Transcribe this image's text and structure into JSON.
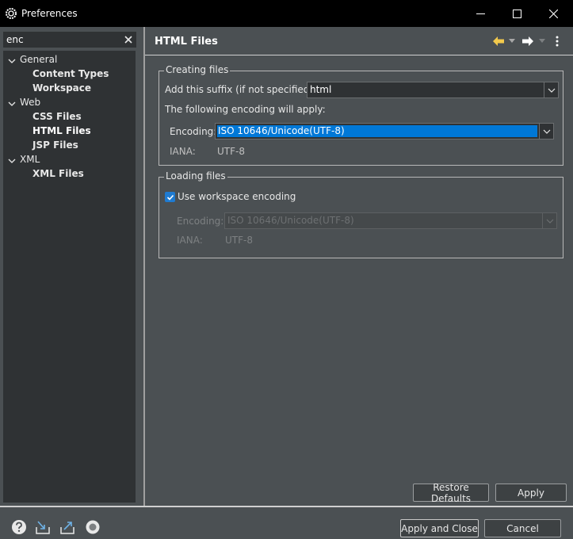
{
  "window": {
    "title": "Preferences",
    "icon": "eclipse-gear-icon"
  },
  "filter": {
    "value": "enc"
  },
  "tree": [
    {
      "label": "General",
      "level": 0,
      "expanded": true
    },
    {
      "label": "Content Types",
      "level": 1
    },
    {
      "label": "Workspace",
      "level": 1
    },
    {
      "label": "Web",
      "level": 0,
      "expanded": true
    },
    {
      "label": "CSS Files",
      "level": 1
    },
    {
      "label": "HTML Files",
      "level": 1,
      "selected": true
    },
    {
      "label": "JSP Files",
      "level": 1
    },
    {
      "label": "XML",
      "level": 0,
      "expanded": true
    },
    {
      "label": "XML Files",
      "level": 1
    }
  ],
  "page": {
    "title": "HTML Files"
  },
  "creating": {
    "legend": "Creating files",
    "suffix_label": "Add this suffix (if not specified):",
    "suffix_value": "html",
    "encoding_note": "The following encoding will apply:",
    "encoding_label": "Encoding:",
    "encoding_value": "ISO 10646/Unicode(UTF-8)",
    "iana_label": "IANA:",
    "iana_value": "UTF-8"
  },
  "loading": {
    "legend": "Loading files",
    "use_workspace_label": "Use workspace encoding",
    "use_workspace_checked": true,
    "encoding_label": "Encoding:",
    "encoding_value": "ISO 10646/Unicode(UTF-8)",
    "iana_label": "IANA:",
    "iana_value": "UTF-8"
  },
  "buttons": {
    "restore_defaults": "Restore Defaults",
    "apply": "Apply",
    "apply_and_close": "Apply and Close",
    "cancel": "Cancel"
  },
  "colors": {
    "accent": "#0078d7",
    "background": "#4b5053",
    "field": "#2f3234",
    "back_arrow": "#f2c94c"
  }
}
